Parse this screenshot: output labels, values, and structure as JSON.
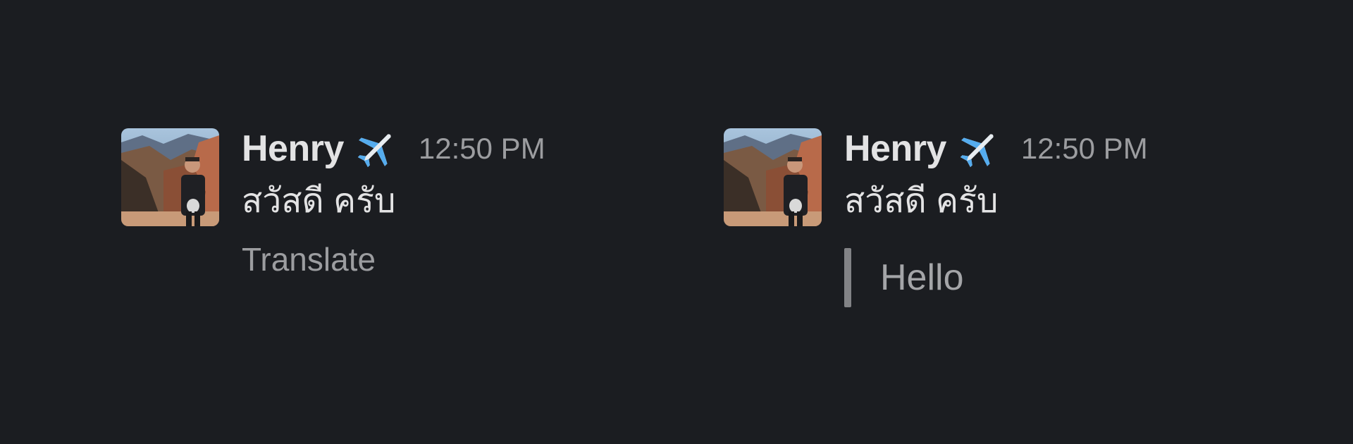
{
  "messages": [
    {
      "author": "Henry",
      "status_emoji": "airplane-emoji",
      "timestamp": "12:50 PM",
      "text": "สวัสดี ครับ",
      "action_label": "Translate"
    },
    {
      "author": "Henry",
      "status_emoji": "airplane-emoji",
      "timestamp": "12:50 PM",
      "text": "สวัสดี ครับ",
      "translation": "Hello"
    }
  ],
  "colors": {
    "background": "#1b1d21",
    "primary_text": "#e3e3e4",
    "secondary_text": "#9c9da0",
    "quote_bar": "#828386"
  }
}
